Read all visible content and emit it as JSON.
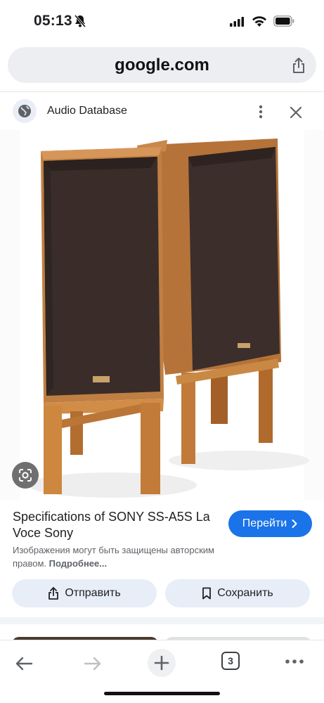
{
  "status": {
    "time": "05:13"
  },
  "browser": {
    "url": "google.com"
  },
  "source": {
    "name": "Audio Database"
  },
  "result": {
    "title": "Specifications of SONY SS-A5S La Voce Sony",
    "go_button": "Перейти",
    "copyright_note": "Изображения могут быть защищены авторским правом.",
    "more_link": "Подробнее...",
    "send_button": "Отправить",
    "save_button": "Сохранить"
  },
  "toolbar": {
    "tab_count": "3"
  },
  "icons": [
    "bell-mute-icon",
    "signal-icon",
    "wifi-icon",
    "battery-icon",
    "share-icon",
    "globe-icon",
    "more-vert-icon",
    "close-icon",
    "google-lens-icon",
    "chevron-right-icon",
    "send-share-icon",
    "bookmark-icon",
    "back-arrow-icon",
    "forward-arrow-icon",
    "plus-icon",
    "tabs-icon",
    "more-horiz-icon"
  ],
  "colors": {
    "accent": "#1a73e8",
    "pill_bg": "#e8eef8",
    "url_bg": "#eceef1"
  }
}
